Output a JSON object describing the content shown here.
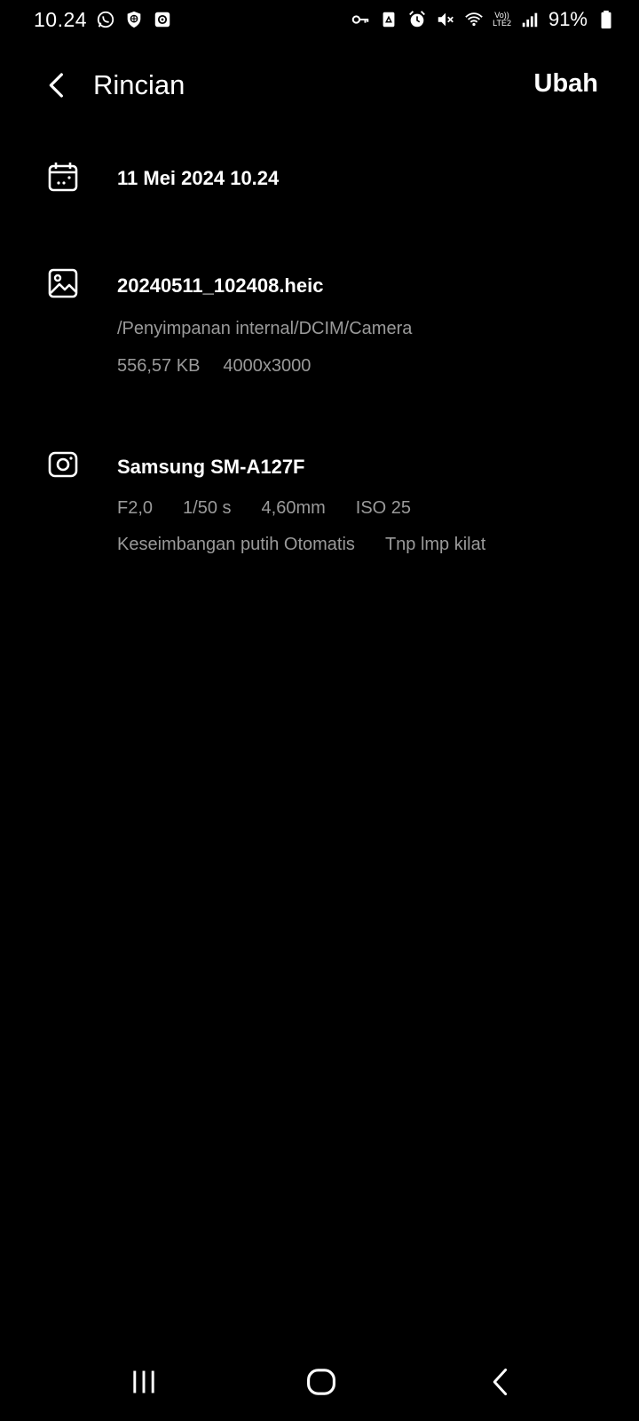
{
  "status_bar": {
    "time": "10.24",
    "battery_percent": "91%",
    "network_label_top": "Vo))",
    "network_label_bottom": "LTE2",
    "icons_left": [
      "whatsapp-icon",
      "vpn-shield-icon",
      "screen-record-icon"
    ],
    "icons_right": [
      "key-icon",
      "recycle-icon",
      "alarm-icon",
      "mute-icon",
      "wifi-icon",
      "signal-icon",
      "battery-icon"
    ]
  },
  "app_bar": {
    "title": "Rincian",
    "edit_label": "Ubah"
  },
  "date_section": {
    "icon": "calendar-icon",
    "datetime": "11 Mei 2024 10.24"
  },
  "file_section": {
    "icon": "image-icon",
    "filename": "20240511_102408.heic",
    "path": "/Penyimpanan internal/DCIM/Camera",
    "size": "556,57 KB",
    "resolution": "4000x3000"
  },
  "camera_section": {
    "icon": "camera-icon",
    "device": "Samsung SM-A127F",
    "aperture": "F2,0",
    "shutter": "1/50 s",
    "focal_length": "4,60mm",
    "iso": "ISO 25",
    "white_balance": "Keseimbangan putih Otomatis",
    "flash": "Tnp lmp kilat"
  },
  "nav_bar": {
    "buttons": [
      "recent-apps-icon",
      "home-icon",
      "back-icon"
    ]
  },
  "colors": {
    "background": "#000000",
    "primary_text": "#ffffff",
    "secondary_text": "#9a9a9a"
  }
}
